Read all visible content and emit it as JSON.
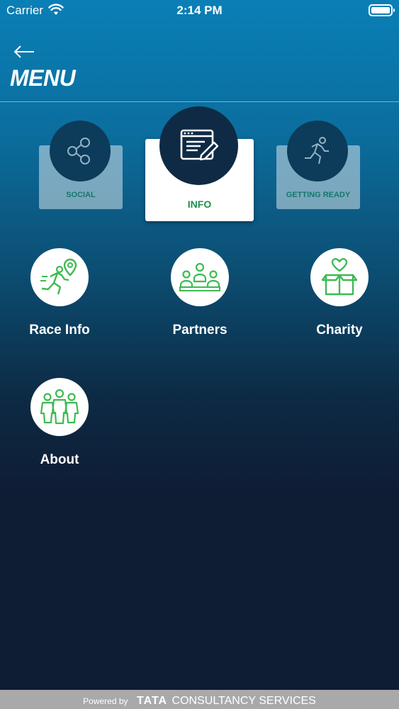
{
  "status_bar": {
    "carrier": "Carrier",
    "time": "2:14 PM"
  },
  "header": {
    "back_icon": "arrow-left-icon",
    "title": "MENU"
  },
  "tabs": [
    {
      "label": "SOCIAL",
      "icon": "share-icon",
      "active": false
    },
    {
      "label": "INFO",
      "icon": "edit-document-icon",
      "active": true
    },
    {
      "label": "GETTING READY",
      "icon": "running-icon",
      "active": false
    }
  ],
  "menu_items": [
    {
      "label": "Race Info",
      "icon": "runner-location-icon"
    },
    {
      "label": "Partners",
      "icon": "partners-icon"
    },
    {
      "label": "Charity",
      "icon": "charity-box-icon"
    },
    {
      "label": "About",
      "icon": "group-icon"
    }
  ],
  "footer": {
    "powered_by": "Powered by",
    "brand": "TATA",
    "company": "CONSULTANCY SERVICES"
  },
  "colors": {
    "accent_green": "#1e8f4e",
    "icon_green": "#3dbb53",
    "dark_navy": "#0f2a44",
    "gradient_top": "#0a7fb6",
    "gradient_bottom": "#0e1c34"
  }
}
